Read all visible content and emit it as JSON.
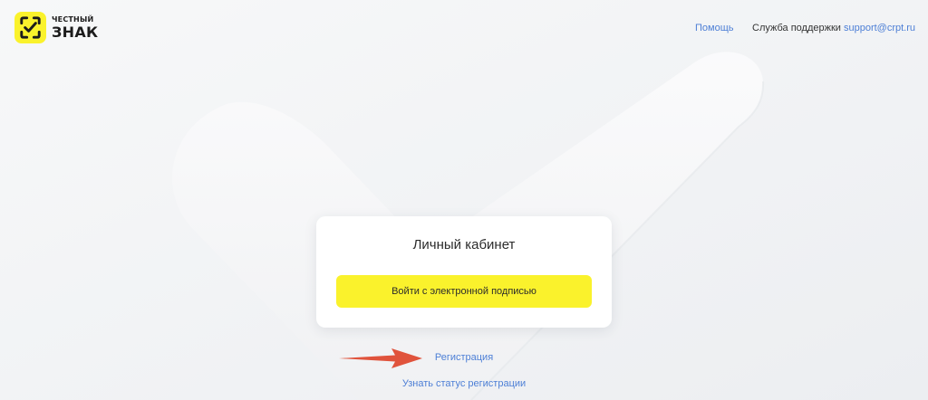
{
  "header": {
    "logo": {
      "line1": "ЧЕСТНЫЙ",
      "line2": "ЗНАК",
      "icon": "check-shield-icon"
    },
    "help_label": "Помощь",
    "support_label": "Служба поддержки",
    "support_email": "support@crpt.ru"
  },
  "card": {
    "title": "Личный кабинет",
    "sign_button_label": "Войти с электронной подписью"
  },
  "links": {
    "registration": "Регистрация",
    "registration_status": "Узнать статус регистрации"
  },
  "colors": {
    "accent_yellow": "#faf22c",
    "link_blue": "#4d7fd6",
    "arrow_red": "#e0533c",
    "background": "#f2f3f5"
  }
}
